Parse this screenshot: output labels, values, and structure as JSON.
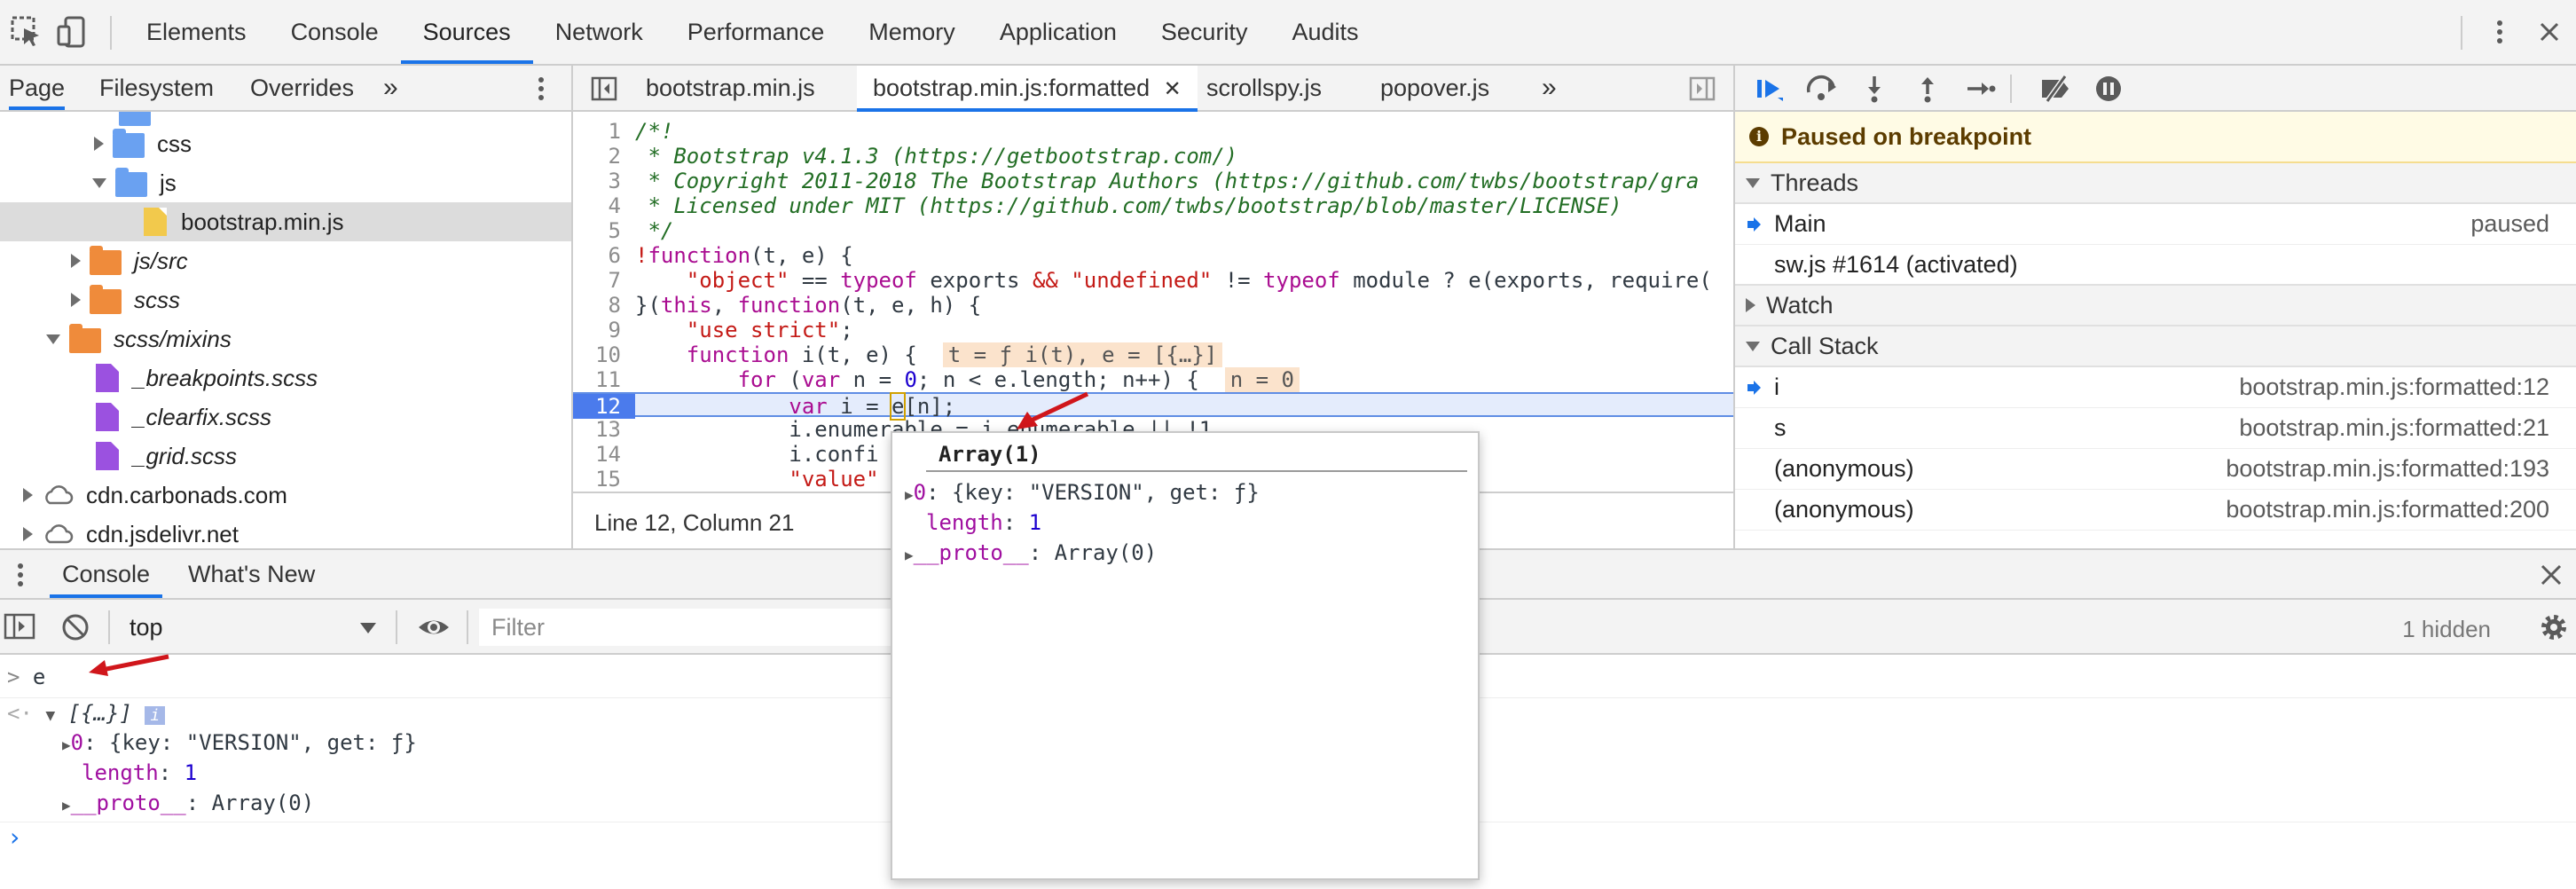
{
  "main_tabs": [
    "Elements",
    "Console",
    "Sources",
    "Network",
    "Performance",
    "Memory",
    "Application",
    "Security",
    "Audits"
  ],
  "active_main_tab": "Sources",
  "navigator": {
    "tabs": [
      "Page",
      "Filesystem",
      "Overrides"
    ],
    "more": "»",
    "tree": [
      {
        "label": "css",
        "kind": "folder-blue",
        "expanded": false
      },
      {
        "label": "js",
        "kind": "folder-blue",
        "expanded": true
      },
      {
        "label": "bootstrap.min.js",
        "kind": "file-yellow",
        "selected": true
      },
      {
        "label": "js/src",
        "kind": "folder-orange",
        "expanded": false
      },
      {
        "label": "scss",
        "kind": "folder-orange",
        "expanded": false
      },
      {
        "label": "scss/mixins",
        "kind": "folder-orange",
        "expanded": true
      },
      {
        "label": "_breakpoints.scss",
        "kind": "file-purple"
      },
      {
        "label": "_clearfix.scss",
        "kind": "file-purple"
      },
      {
        "label": "_grid.scss",
        "kind": "file-purple"
      },
      {
        "label": "cdn.carbonads.com",
        "kind": "cloud",
        "expanded": false
      },
      {
        "label": "cdn.jsdelivr.net",
        "kind": "cloud",
        "expanded": false
      }
    ]
  },
  "editor": {
    "tabs": [
      "bootstrap.min.js",
      "bootstrap.min.js:formatted",
      "scrollspy.js",
      "popover.js"
    ],
    "active_tab": "bootstrap.min.js:formatted",
    "more": "»",
    "lines": [
      {
        "n": "1",
        "text": "/*!"
      },
      {
        "n": "2",
        "text": " * Bootstrap v4.1.3 (https://getbootstrap.com/)"
      },
      {
        "n": "3",
        "text": " * Copyright 2011-2018 The Bootstrap Authors (https://github.com/twbs/bootstrap/gra"
      },
      {
        "n": "4",
        "text": " * Licensed under MIT (https://github.com/twbs/bootstrap/blob/master/LICENSE)"
      },
      {
        "n": "5",
        "text": " */"
      },
      {
        "n": "6",
        "text": "!function(t, e) {"
      },
      {
        "n": "7",
        "text": "    \"object\" == typeof exports && \"undefined\" != typeof module ? e(exports, require("
      },
      {
        "n": "8",
        "text": "}(this, function(t, e, h) {"
      },
      {
        "n": "9",
        "text": "    \"use strict\";"
      },
      {
        "n": "10",
        "text": "    function i(t, e) {"
      },
      {
        "n": "11",
        "text": "        for (var n = 0; n < e.length; n++) {"
      },
      {
        "n": "12",
        "text": "            var i = e[n];"
      },
      {
        "n": "13",
        "text": "            i.enumerable = i.enumerable || !1"
      },
      {
        "n": "14",
        "text": "            i.confi"
      },
      {
        "n": "15",
        "text": "            \"value\""
      }
    ],
    "inline_values": {
      "line10": "t = ƒ i(t), e = [{…}]",
      "line11": "n = 0"
    },
    "status": "Line 12, Column 21"
  },
  "debugger": {
    "paused_message": "Paused on breakpoint",
    "threads_header": "Threads",
    "threads": [
      {
        "name": "Main",
        "state": "paused"
      },
      {
        "name": "sw.js #1614 (activated)",
        "state": ""
      }
    ],
    "watch_header": "Watch",
    "callstack_header": "Call Stack",
    "call_stack": [
      {
        "fn": "i",
        "loc": "bootstrap.min.js:formatted:12"
      },
      {
        "fn": "s",
        "loc": "bootstrap.min.js:formatted:21"
      },
      {
        "fn": "(anonymous)",
        "loc": "bootstrap.min.js:formatted:193"
      },
      {
        "fn": "(anonymous)",
        "loc": "bootstrap.min.js:formatted:200"
      }
    ]
  },
  "drawer": {
    "tabs": [
      "Console",
      "What's New"
    ],
    "context": "top",
    "filter_placeholder": "Filter",
    "hidden": "1 hidden"
  },
  "console": {
    "input": "e",
    "result_summary": "[{…}]",
    "info_badge": "i",
    "item0_key": "0",
    "item0_value": "{key: \"VERSION\", get: ƒ}",
    "length_key": "length",
    "length_value": "1",
    "proto_key": "__proto__",
    "proto_value": "Array(0)",
    "prompt": "›"
  },
  "popover": {
    "title": "Array(1)",
    "item0_key": "0",
    "item0_value": "{key: \"VERSION\", get: ƒ}",
    "length_key": "length",
    "length_value": "1",
    "proto_key": "__proto__",
    "proto_value": "Array(0)"
  },
  "colors": {
    "accent": "#1a73e8",
    "arrow": "#d0161b",
    "paused_bg": "#fffbe5",
    "exec_line": "#4b7bec"
  }
}
